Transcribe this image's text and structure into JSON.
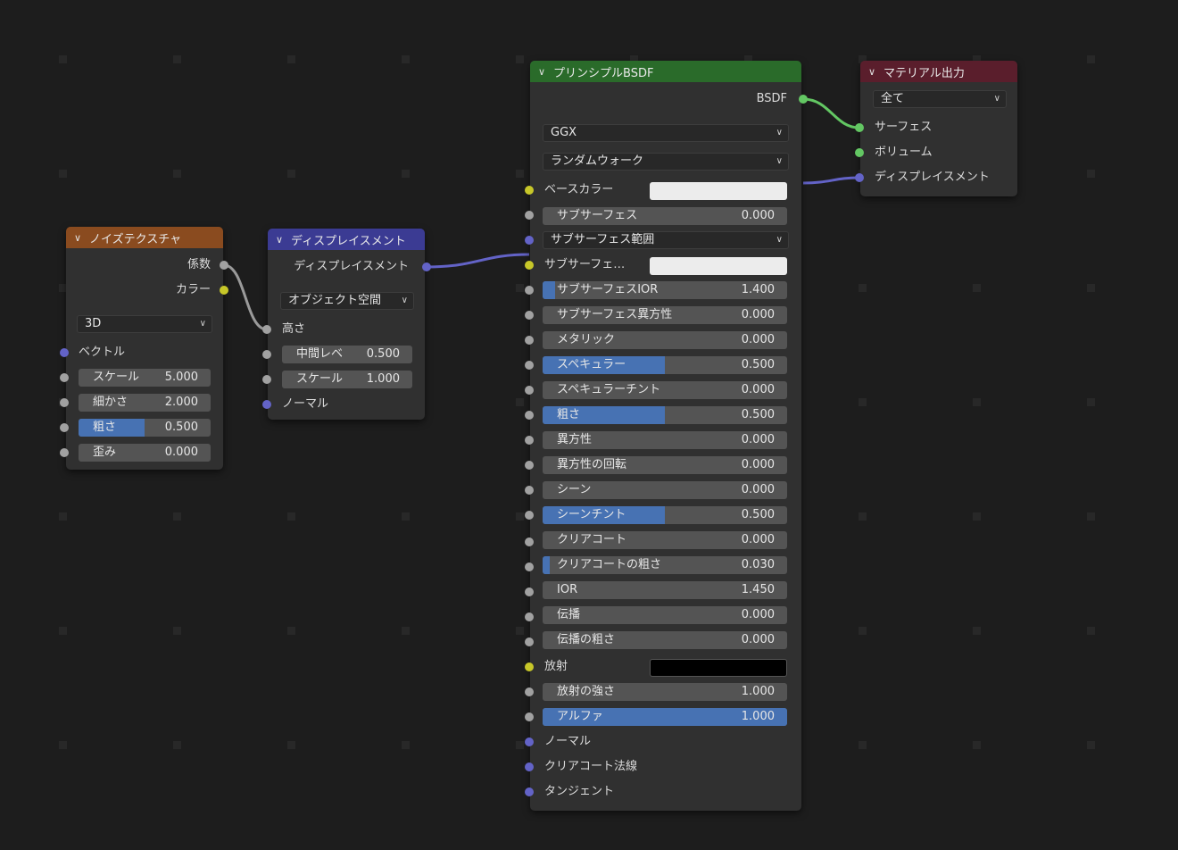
{
  "noise_node": {
    "title": "ノイズテクスチャ",
    "header_color": "#8a4b1f",
    "out_fac": "係数",
    "out_color": "カラー",
    "dimension": "3D",
    "in_vector": "ベクトル",
    "fields": [
      {
        "label": "スケール",
        "value": "5.000",
        "fill": 0
      },
      {
        "label": "細かさ",
        "value": "2.000",
        "fill": 0
      },
      {
        "label": "粗さ",
        "value": "0.500",
        "fill": 0.5
      },
      {
        "label": "歪み",
        "value": "0.000",
        "fill": 0
      }
    ]
  },
  "disp_node": {
    "title": "ディスプレイスメント",
    "header_color": "#3b3b93",
    "out_disp": "ディスプレイスメント",
    "space": "オブジェクト空間",
    "in_height": "高さ",
    "fields": [
      {
        "label": "中間レベ",
        "value": "0.500",
        "fill": 0
      },
      {
        "label": "スケール",
        "value": "1.000",
        "fill": 0
      }
    ],
    "in_normal": "ノーマル"
  },
  "bsdf_node": {
    "title": "プリンシプルBSDF",
    "header_color": "#2a6b2a",
    "out_bsdf": "BSDF",
    "distribution": "GGX",
    "subsurface_method": "ランダムウォーク",
    "base_color_label": "ベースカラー",
    "base_color": "#ececec",
    "subsurface_label": "サブサーフェス",
    "subsurface_value": "0.000",
    "subsurface_radius": "サブサーフェス範囲",
    "subsurface_color_label": "サブサーフェ…",
    "subsurface_color": "#ececec",
    "fields": [
      {
        "label": "サブサーフェスIOR",
        "value": "1.400",
        "fill": 0.05
      },
      {
        "label": "サブサーフェス異方性",
        "value": "0.000",
        "fill": 0
      },
      {
        "label": "メタリック",
        "value": "0.000",
        "fill": 0
      },
      {
        "label": "スペキュラー",
        "value": "0.500",
        "fill": 0.5
      },
      {
        "label": "スペキュラーチント",
        "value": "0.000",
        "fill": 0
      },
      {
        "label": "粗さ",
        "value": "0.500",
        "fill": 0.5
      },
      {
        "label": "異方性",
        "value": "0.000",
        "fill": 0
      },
      {
        "label": "異方性の回転",
        "value": "0.000",
        "fill": 0
      },
      {
        "label": "シーン",
        "value": "0.000",
        "fill": 0
      },
      {
        "label": "シーンチント",
        "value": "0.500",
        "fill": 0.5
      },
      {
        "label": "クリアコート",
        "value": "0.000",
        "fill": 0
      },
      {
        "label": "クリアコートの粗さ",
        "value": "0.030",
        "fill": 0.03
      },
      {
        "label": "IOR",
        "value": "1.450",
        "fill": 0
      },
      {
        "label": "伝播",
        "value": "0.000",
        "fill": 0
      },
      {
        "label": "伝播の粗さ",
        "value": "0.000",
        "fill": 0
      }
    ],
    "emission_label": "放射",
    "emission_color": "#000000",
    "fields2": [
      {
        "label": "放射の強さ",
        "value": "1.000",
        "fill": 0
      },
      {
        "label": "アルファ",
        "value": "1.000",
        "fill": 1
      }
    ],
    "in_normal": "ノーマル",
    "in_clearcoat_normal": "クリアコート法線",
    "in_tangent": "タンジェント"
  },
  "output_node": {
    "title": "マテリアル出力",
    "header_color": "#5a1e2c",
    "target": "全て",
    "in_surface": "サーフェス",
    "in_volume": "ボリューム",
    "in_displacement": "ディスプレイスメント"
  },
  "colors": {
    "background": "#1d1d1d",
    "node_body": "#303030",
    "field": "#545454",
    "slider_fill": "#4772b3",
    "socket_gray": "#a1a1a1",
    "socket_yellow": "#c7c729",
    "socket_blue": "#6363c7",
    "socket_green": "#63c763"
  }
}
